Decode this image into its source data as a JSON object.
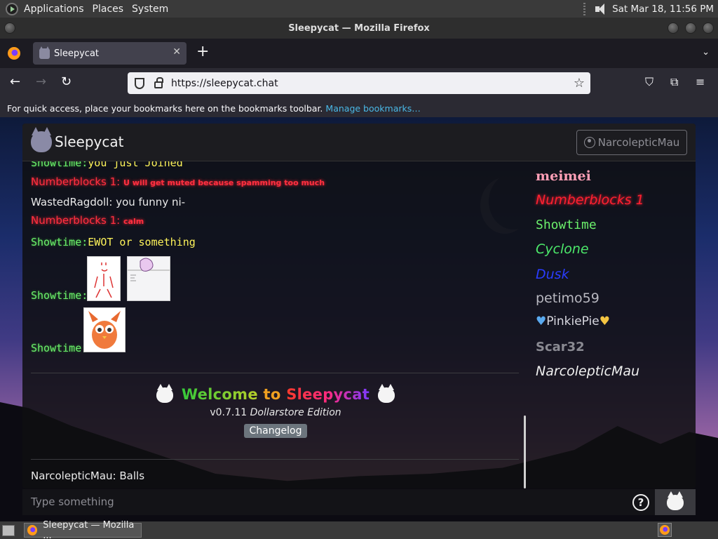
{
  "os_panel": {
    "menus": [
      "Applications",
      "Places",
      "System"
    ],
    "clock": "Sat Mar 18, 11:56 PM"
  },
  "window": {
    "title": "Sleepycat — Mozilla Firefox"
  },
  "browser": {
    "tab_title": "Sleepycat",
    "url": "https://sleepycat.chat",
    "bookmarks_hint": "For quick access, place your bookmarks here on the bookmarks toolbar.",
    "bookmarks_link": "Manage bookmarks…"
  },
  "app": {
    "name": "Sleepycat",
    "login_user": "NarcolepticMau",
    "input_placeholder": "Type something",
    "help_label": "?"
  },
  "messages": [
    {
      "user": "Showtime:",
      "text": "you just Joined"
    },
    {
      "user": "Numberblocks 1:",
      "text": "U will get muted because spamming too much"
    },
    {
      "user": "WastedRagdoll:",
      "text": "you funny ni-"
    },
    {
      "user": "Numberblocks 1:",
      "text": "calm"
    },
    {
      "user": "Showtime:",
      "text": "EWOT or something"
    },
    {
      "user": "Showtime:",
      "text": ""
    },
    {
      "user": "Showtime:",
      "text": ""
    },
    {
      "user": "NarcolepticMau:",
      "text": "Balls"
    }
  ],
  "welcome": {
    "word1": "Welcome",
    "word2": "to",
    "word3": "Sleepycat",
    "version": "v0.7.11",
    "edition": "Dollarstore Edition",
    "changelog_label": "Changelog"
  },
  "users": [
    "meimei",
    "Numberblocks 1",
    "Showtime",
    "Cyclone",
    "Dusk",
    "petimo59",
    "PinkiePie",
    "Scar32",
    "NarcolepticMau"
  ],
  "taskbar": {
    "window_label": "Sleepycat — Mozilla ..."
  },
  "colors": {
    "accent_link": "#4ab8e6",
    "red_user": "#ff3040",
    "green_user": "#6cf06c",
    "yellow_text": "#fff45a",
    "dusk_blue": "#2a3cff"
  }
}
